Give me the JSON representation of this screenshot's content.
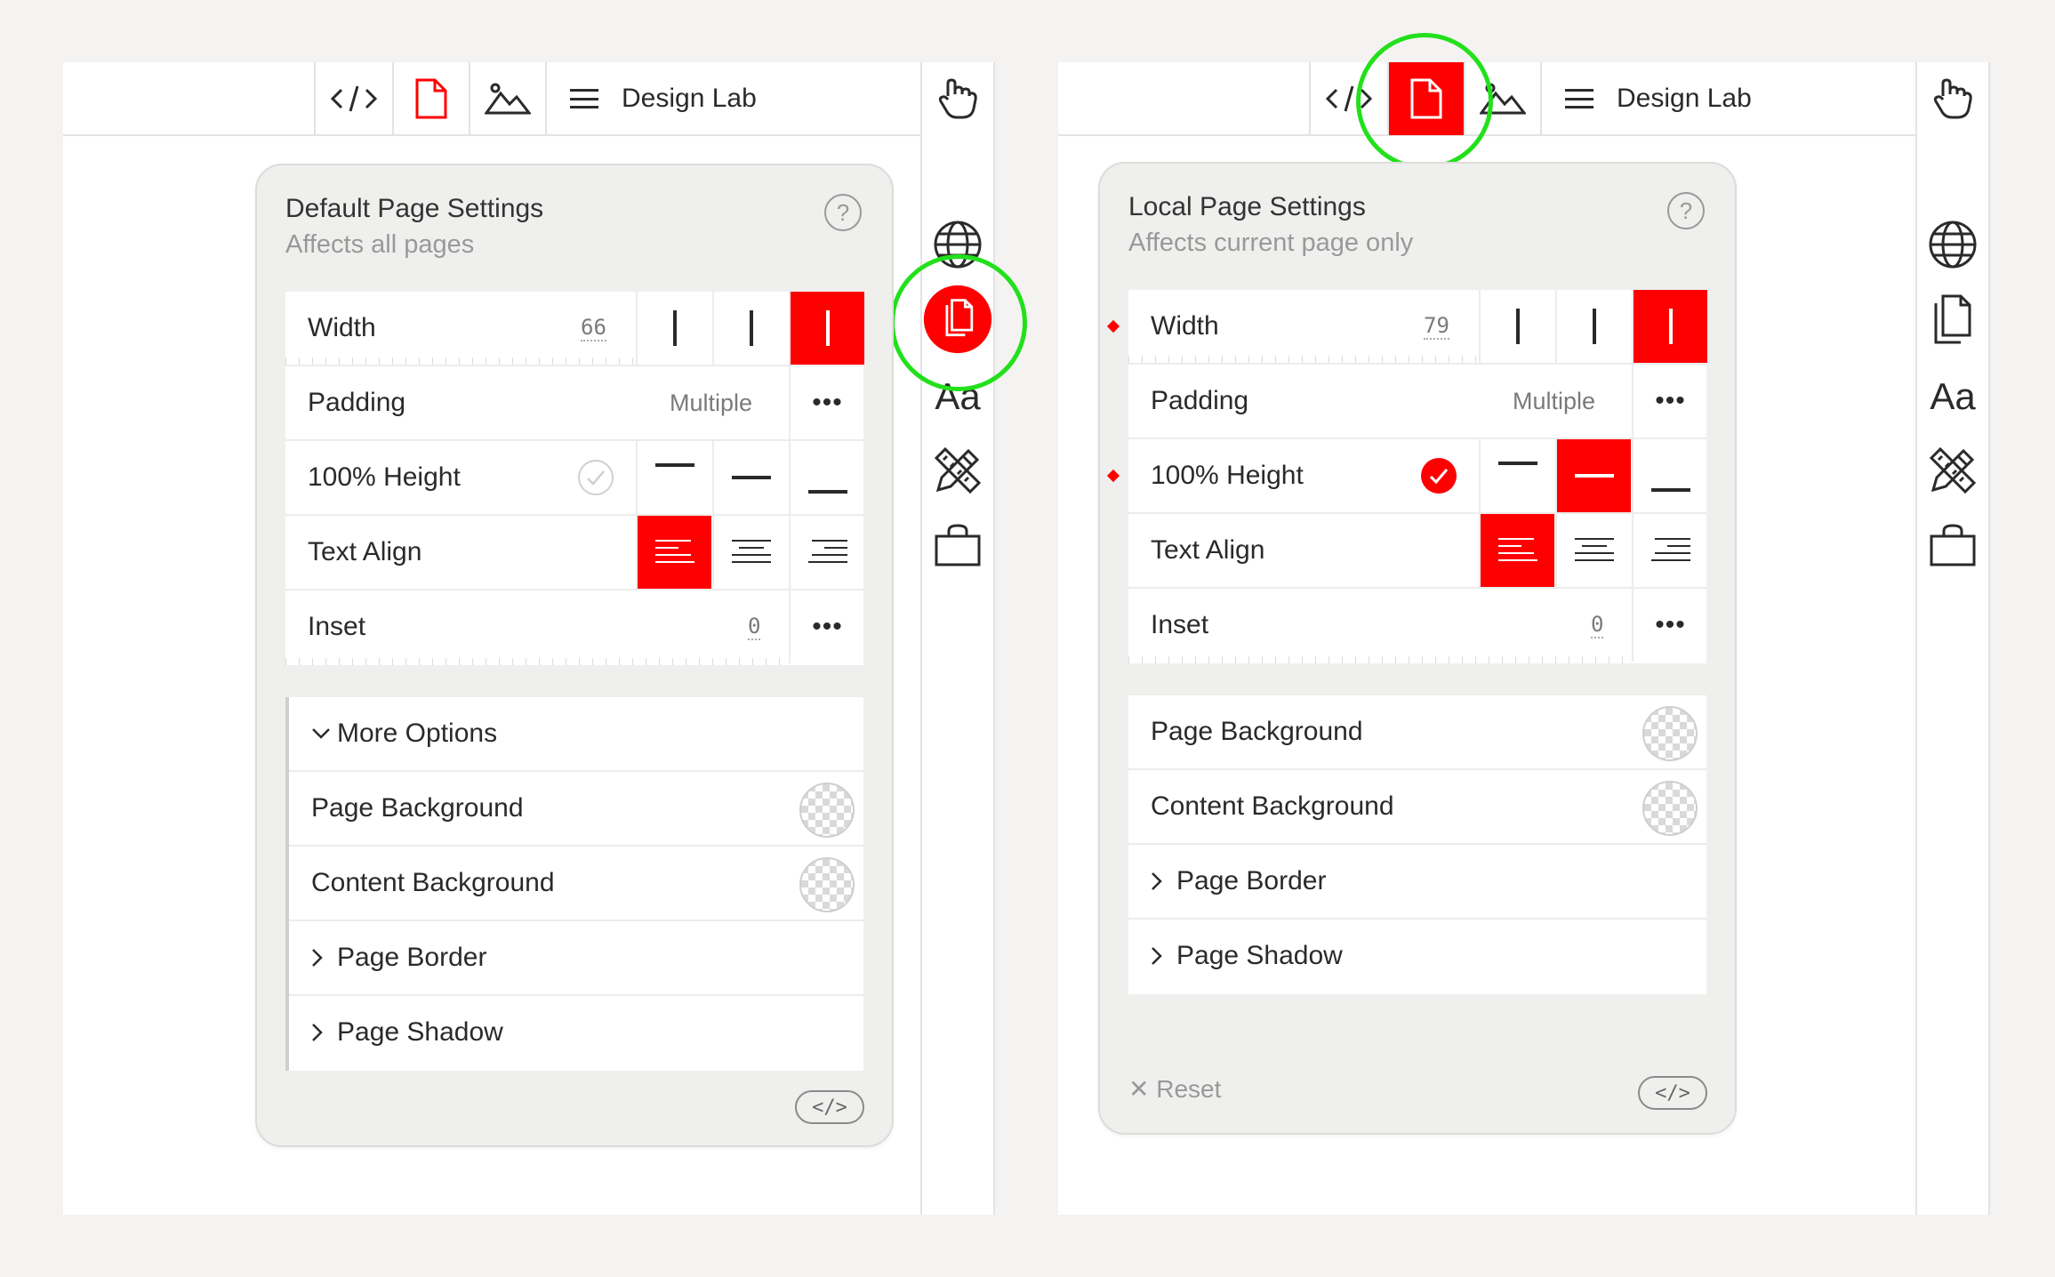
{
  "app": {
    "title": "Design Lab"
  },
  "accent_color": "#ff0000",
  "highlight_color": "#22e01c",
  "left": {
    "panel": {
      "title": "Default Page Settings",
      "subtitle": "Affects all pages",
      "help": "?",
      "rows": {
        "width": {
          "label": "Width",
          "value": "66"
        },
        "padding": {
          "label": "Padding",
          "value": "Multiple",
          "more": "•••"
        },
        "height": {
          "label": "100% Height"
        },
        "align": {
          "label": "Text Align"
        },
        "inset": {
          "label": "Inset",
          "value": "0",
          "more": "•••"
        }
      },
      "options": {
        "more": "More Options",
        "page_bg": "Page Background",
        "content_bg": "Content Background",
        "border": "Page Border",
        "shadow": "Page Shadow"
      },
      "code": "</>"
    },
    "sidebar": {
      "typography": "Aa"
    }
  },
  "right": {
    "panel": {
      "title": "Local Page Settings",
      "subtitle": "Affects current page only",
      "help": "?",
      "rows": {
        "width": {
          "label": "Width",
          "value": "79"
        },
        "padding": {
          "label": "Padding",
          "value": "Multiple",
          "more": "•••"
        },
        "height": {
          "label": "100% Height"
        },
        "align": {
          "label": "Text Align"
        },
        "inset": {
          "label": "Inset",
          "value": "0",
          "more": "•••"
        }
      },
      "options": {
        "page_bg": "Page Background",
        "content_bg": "Content Background",
        "border": "Page Border",
        "shadow": "Page Shadow"
      },
      "reset": "✕ Reset",
      "code": "</>"
    },
    "sidebar": {
      "typography": "Aa"
    }
  }
}
